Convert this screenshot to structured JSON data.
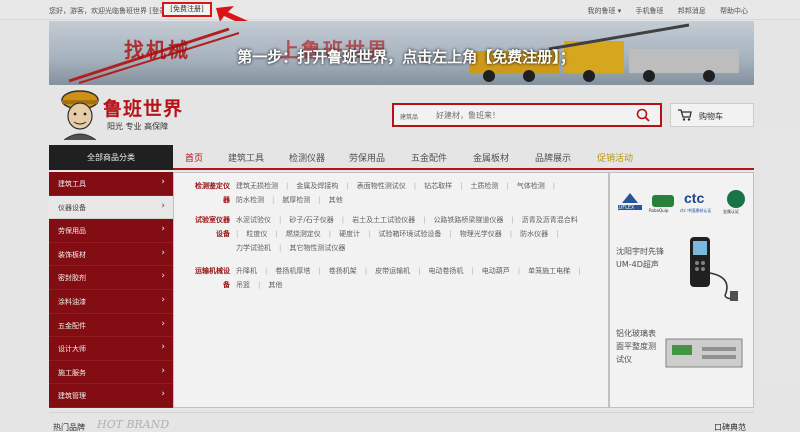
{
  "topbar": {
    "greeting": "您好，游客，欢迎光临鲁班世界 [登录]",
    "register": "[免费注册]",
    "links": [
      "我的鲁班 ▾",
      "手机鲁班",
      "邦邦消息",
      "帮助中心"
    ]
  },
  "banner": {
    "slogan_a": "找机械",
    "slogan_b": "上鲁班世界",
    "instruction": "第一步：打开鲁班世界，点击左上角【免费注册】；"
  },
  "logo": {
    "brand": "鲁班世界",
    "tagline": "阳光  专业  高保障"
  },
  "search": {
    "category": "建筑品",
    "placeholder": "好建材，鲁班来！"
  },
  "cart": {
    "label": "购物车"
  },
  "nav": {
    "all_categories": "全部商品分类",
    "items": [
      "首页",
      "建筑工具",
      "检测仪器",
      "劳保用品",
      "五金配件",
      "金属板材",
      "品牌展示",
      "促销活动"
    ]
  },
  "sidebar": {
    "items": [
      "建筑工具",
      "仪器设备",
      "劳保用品",
      "装饰板材",
      "密封胶剂",
      "涂料油漆",
      "五金配件",
      "设计大师",
      "施工服务",
      "建筑管理"
    ]
  },
  "categories": [
    {
      "title": "检测鉴定仪器",
      "items": [
        "建筑无损检测",
        "金属及焊接构",
        "表面物性测试仪",
        "钻芯取样",
        "土质检测",
        "气体检测",
        "防水检测",
        "腻厚检测",
        "其他"
      ]
    },
    {
      "title": "试验室仪器设备",
      "items": [
        "水泥试验仪",
        "砂子/石子仪器",
        "岩土及土工试验仪器",
        "公路铁路桥梁隧道仪器",
        "沥青及沥青混合料",
        "粒度仪",
        "燃烧测定仪",
        "硬度计",
        "试验箱环境试验设备",
        "物理光学仪器",
        "防水仪器",
        "力学试验机",
        "其它物性测试仪器"
      ]
    },
    {
      "title": "运输机械设备",
      "items": [
        "升降机",
        "卷扬机厚塔",
        "卷扬机架",
        "皮带运输机",
        "电动卷扬机",
        "电动葫芦",
        "单笼施工电梯",
        "吊篮",
        "其他"
      ]
    }
  ],
  "right": {
    "brand_logos": [
      "LUFLEX",
      "RoboQuip",
      "ctc 中国建材认证",
      "金属认证"
    ],
    "promo1": "沈阳宇时先锋UM-4D超声",
    "promo2": "铝化玻璃表面平整度测试仪"
  },
  "bottom": {
    "hot_brand": "热门品牌",
    "hot_brand_en": "HOT BRAND",
    "kb": "口碑典范"
  },
  "colors": {
    "brand_red": "#c1121a",
    "dark": "#222222",
    "sidebar": "#8a0e13"
  }
}
